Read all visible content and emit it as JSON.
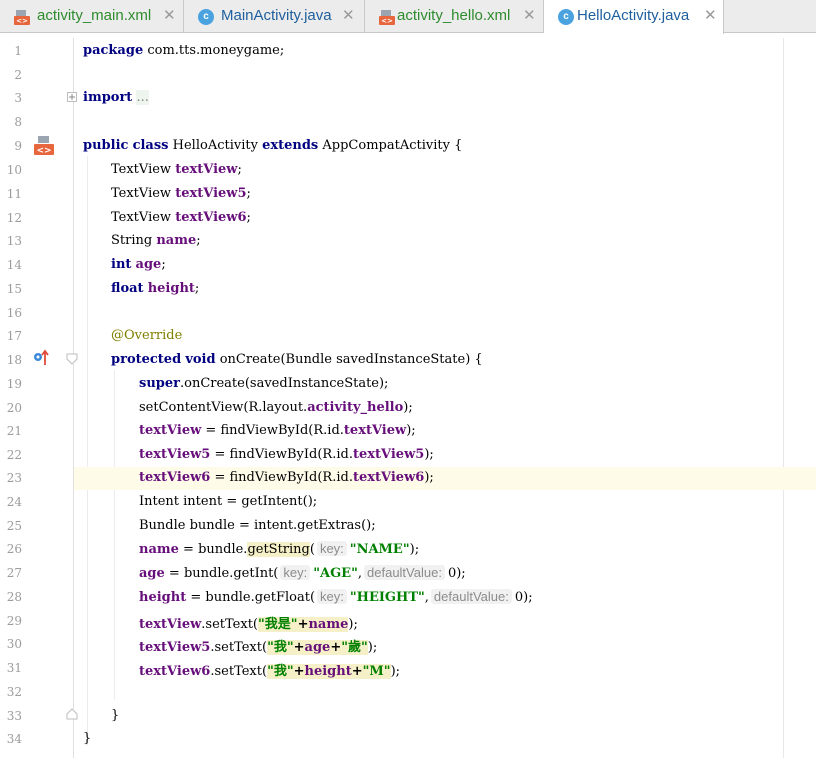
{
  "tabs": [
    {
      "label": "activity_main.xml",
      "type": "xml",
      "active": false
    },
    {
      "label": "MainActivity.java",
      "type": "java",
      "active": false
    },
    {
      "label": "activity_hello.xml",
      "type": "xml",
      "active": false
    },
    {
      "label": "HelloActivity.java",
      "type": "java",
      "active": true
    }
  ],
  "tab_close": "✕",
  "java_icon_letter": "c",
  "colors": {
    "keyword": "#000080",
    "field": "#660e7a",
    "string": "#008000",
    "annotation": "#808000",
    "xml_tab_text": "#2e8b2e",
    "java_tab_text": "#1f5f9e",
    "current_line": "#fefbe8"
  },
  "gutter_icons": {
    "line9": "xml-layout-icon",
    "line18": "override-method-icon"
  },
  "lines": [
    {
      "n": "1",
      "t": "package com.tts.moneygame;"
    },
    {
      "n": "2",
      "t": ""
    },
    {
      "n": "3",
      "kw": "import",
      "fold": "..."
    },
    {
      "n": "8",
      "t": ""
    },
    {
      "n": "9",
      "kw1": "public",
      "kw2": "class",
      "t1": "HelloActivity",
      "kw3": "extends",
      "t2": "AppCompatActivity {"
    },
    {
      "n": "10",
      "t": "TextView",
      "f": "textView",
      "e": ";"
    },
    {
      "n": "11",
      "t": "TextView",
      "f": "textView5",
      "e": ";"
    },
    {
      "n": "12",
      "t": "TextView",
      "f": "textView6",
      "e": ";"
    },
    {
      "n": "13",
      "t": "String",
      "f": "name",
      "e": ";"
    },
    {
      "n": "14",
      "kw": "int",
      "f": "age",
      "e": ";"
    },
    {
      "n": "15",
      "kw": "float",
      "f": "height",
      "e": ";"
    },
    {
      "n": "16",
      "t": ""
    },
    {
      "n": "17",
      "ann": "@Override"
    },
    {
      "n": "18",
      "kw1": "protected",
      "kw2": "void",
      "t": "onCreate(Bundle savedInstanceState) {"
    },
    {
      "n": "19",
      "kw": "super",
      "t": ".onCreate(savedInstanceState);"
    },
    {
      "n": "20",
      "t1": "setContentView(R.layout.",
      "f": "activity_hello",
      "t2": ");"
    },
    {
      "n": "21",
      "f1": "textView",
      "t1": " = findViewById(R.id.",
      "f2": "textView",
      "t2": ");"
    },
    {
      "n": "22",
      "f1": "textView5",
      "t1": " = findViewById(R.id.",
      "f2": "textView5",
      "t2": ");"
    },
    {
      "n": "23",
      "f1": "textView6",
      "t1": " = findViewById(R.id.",
      "f2": "textView6",
      "t2": ");"
    },
    {
      "n": "24",
      "t": "Intent intent = getIntent();"
    },
    {
      "n": "25",
      "t": "Bundle bundle = intent.getExtras();"
    },
    {
      "n": "26",
      "f": "name",
      "t1": " = bundle.",
      "m": "getString",
      "t2": "(",
      "h1": "key:",
      "s1": "\"NAME\"",
      "t3": ");"
    },
    {
      "n": "27",
      "f": "age",
      "t1": " = bundle.getInt(",
      "h1": "key:",
      "s1": "\"AGE\"",
      "t2": ",",
      "h2": "defaultValue:",
      "t3": "0);"
    },
    {
      "n": "28",
      "f": "height",
      "t1": " = bundle.getFloat(",
      "h1": "key:",
      "s1": "\"HEIGHT\"",
      "t2": ",",
      "h2": "defaultValue:",
      "t3": "0);"
    },
    {
      "n": "29",
      "f1": "textView",
      "t1": ".setText(",
      "s1": "\"我是\"",
      "p1": "+",
      "f2": "name",
      "t2": ");"
    },
    {
      "n": "30",
      "f1": "textView5",
      "t1": ".setText(",
      "s1": "\"我\"",
      "p1": "+",
      "f2": "age",
      "p2": "+",
      "s2": "\"歲\"",
      "t2": ");"
    },
    {
      "n": "31",
      "f1": "textView6",
      "t1": ".setText(",
      "s1": "\"我\"",
      "p1": "+",
      "f2": "height",
      "p2": "+",
      "s2": "\"M\"",
      "t2": ");"
    },
    {
      "n": "32",
      "t": ""
    },
    {
      "n": "33",
      "t": "}"
    },
    {
      "n": "34",
      "t": "}"
    }
  ]
}
